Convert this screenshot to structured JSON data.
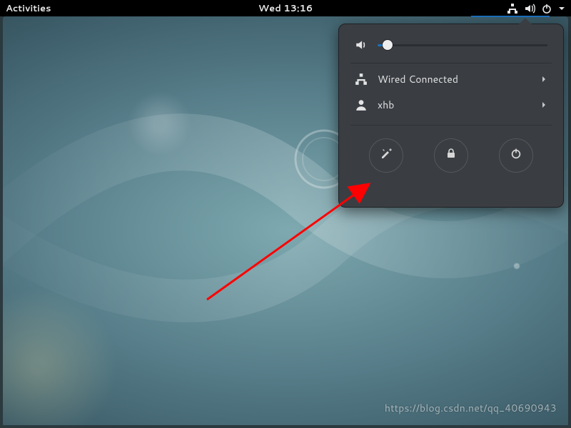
{
  "topbar": {
    "activities": "Activities",
    "datetime": "Wed 13:16"
  },
  "sysmenu": {
    "network_label": "Wired Connected",
    "user_label": "xhb",
    "volume_percent": 6
  },
  "watermark": "https://blog.csdn.net/qq_40690943"
}
